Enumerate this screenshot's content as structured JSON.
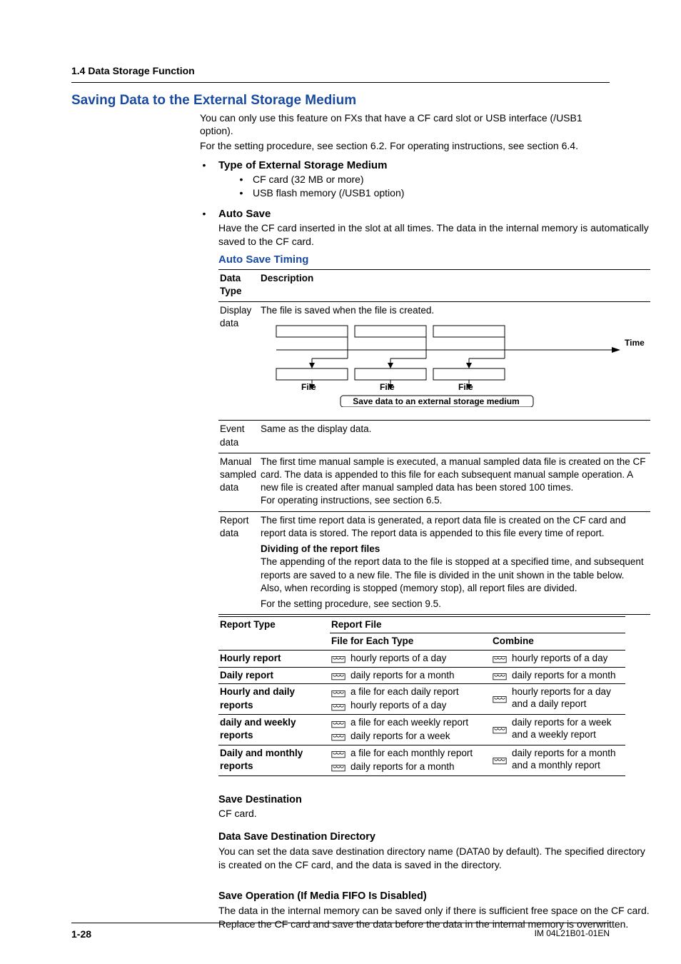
{
  "section_header": "1.4  Data Storage Function",
  "main_heading": "Saving Data to the External Storage Medium",
  "intro": [
    "You can only use this feature on FXs that have a CF card slot or USB interface (/USB1 option).",
    "For the setting procedure, see section 6.2. For operating instructions, see section 6.4."
  ],
  "type_ext": {
    "title": "Type of External Storage Medium",
    "items": [
      "CF card (32 MB or more)",
      "USB flash memory (/USB1 option)"
    ]
  },
  "auto_save": {
    "title": "Auto Save",
    "text": "Have the CF card inserted in the slot at all times. The data in the internal memory is automatically saved to the CF card.",
    "timing_heading": "Auto Save Timing"
  },
  "as_table": {
    "headers": [
      "Data Type",
      "Description"
    ],
    "display_data_label": "Display data",
    "display_data_desc": "The file is saved when the file is created.",
    "diagram": {
      "time": "Time",
      "file": "File",
      "caption": "Save data to an external storage medium"
    },
    "event_data": {
      "label": "Event data",
      "desc": "Same as the display data."
    },
    "manual": {
      "label": "Manual sampled data",
      "lines": [
        "The first time manual sample is executed, a manual sampled data file is created on the CF card. The data is appended to this file for each subsequent manual sample operation. A new file is created after manual sampled data has been stored 100 times.",
        "For operating instructions, see section 6.5."
      ]
    },
    "report": {
      "label": "Report data",
      "lines": [
        "The first time report data is generated, a report data file is created on the CF card and report data is stored. The report data is appended to this file every time of report."
      ],
      "div_heading": "Dividing of the report files",
      "div_lines": [
        "The appending of the report data to the file is stopped at a specified time, and subsequent reports are saved to a new file. The file is divided in the unit shown in the table below. Also, when recording is stopped (memory stop), all report files are divided.",
        "For the setting procedure, see section 9.5."
      ]
    }
  },
  "rt_table": {
    "h1": [
      "Report Type",
      "Report File"
    ],
    "h2": [
      "File for Each Type",
      "Combine"
    ],
    "rows": [
      {
        "type": "Hourly report",
        "f": [
          "hourly reports of a day"
        ],
        "c": [
          "hourly reports of a day"
        ],
        "c_extra": ""
      },
      {
        "type": "Daily report",
        "f": [
          "daily reports for a month"
        ],
        "c": [
          "daily reports for a month"
        ],
        "c_extra": ""
      },
      {
        "type": "Hourly and daily reports",
        "f": [
          "a file for each daily report",
          "hourly reports of a day"
        ],
        "c": [
          "hourly reports for a day and a daily report"
        ],
        "c_extra": ""
      },
      {
        "type": "daily and weekly reports",
        "f": [
          "a file for each weekly report",
          "daily reports for a week"
        ],
        "c": [
          "daily reports for a week and a weekly report"
        ],
        "c_extra": ""
      },
      {
        "type": "Daily and monthly reports",
        "f": [
          "a file for each monthly report",
          "daily reports for a month"
        ],
        "c": [
          "daily reports for a month and a monthly report"
        ],
        "c_extra": ""
      }
    ]
  },
  "save_dest": {
    "title": "Save Destination",
    "text": "CF card."
  },
  "dir": {
    "title": "Data Save Destination Directory",
    "text": "You can set the data save destination directory name (DATA0 by default). The specified directory is created on the CF card, and the data is saved in the directory."
  },
  "saveop": {
    "title": "Save Operation (If Media FIFO Is Disabled)",
    "text": "The data in the internal memory can be saved only if there is sufficient free space on the CF card. Replace the CF card and save the data before the data in the internal memory is overwritten."
  },
  "footer": {
    "page": "1-28",
    "doc": "IM 04L21B01-01EN"
  }
}
